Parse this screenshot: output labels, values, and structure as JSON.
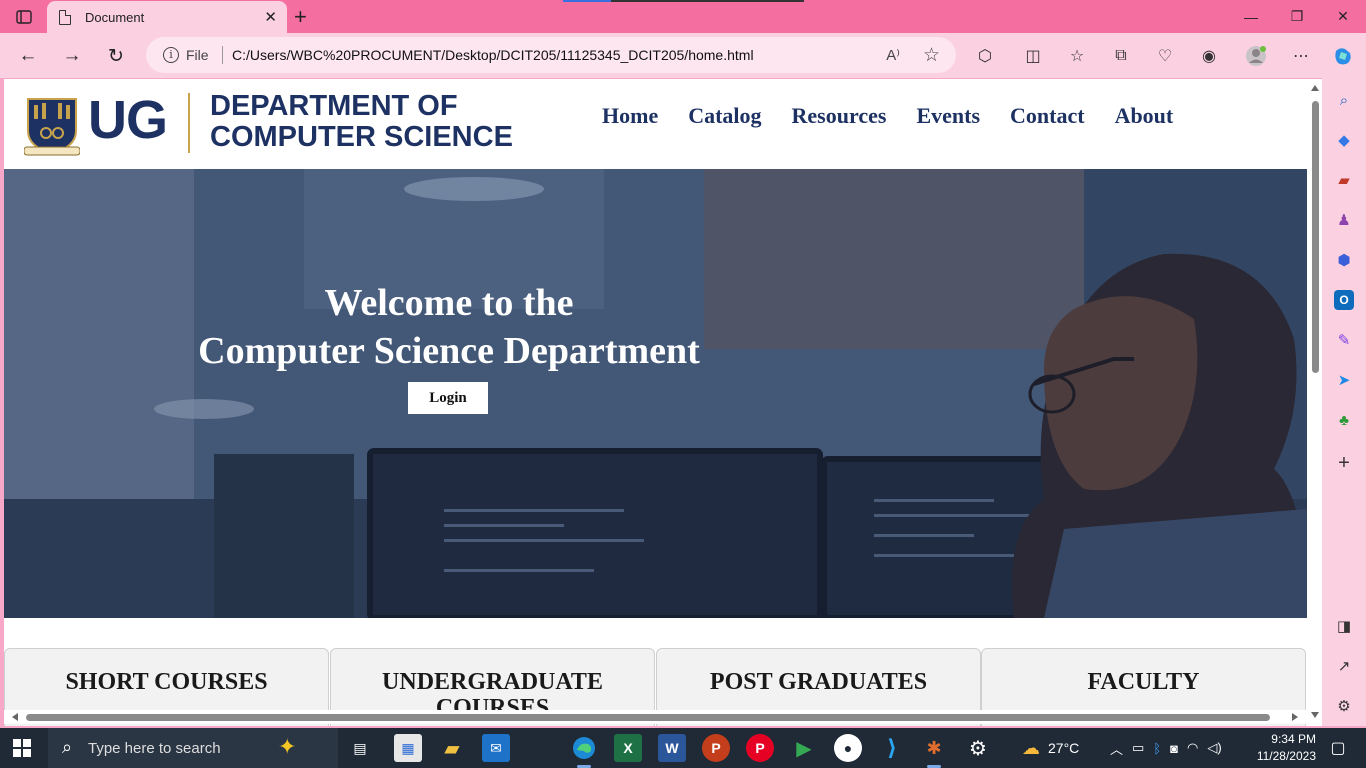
{
  "browser": {
    "tab_title": "Document",
    "file_label": "File",
    "url": "C:/Users/WBC%20PROCUMENT/Desktop/DCIT205/11125345_DCIT205/home.html",
    "read_aloud_glyph": "A⁾"
  },
  "site": {
    "logo_ug": "UG",
    "logo_line1": "DEPARTMENT OF",
    "logo_line2": "COMPUTER SCIENCE",
    "nav": [
      "Home",
      "Catalog",
      "Resources",
      "Events",
      "Contact",
      "About"
    ],
    "hero_line1": "Welcome to the",
    "hero_line2": "Computer Science Department",
    "login_label": "Login",
    "cards": [
      "SHORT COURSES",
      "UNDERGRADUATE COURSES",
      "POST GRADUATES",
      "FACULTY"
    ]
  },
  "taskbar": {
    "search_placeholder": "Type here to search",
    "weather": "27°C",
    "time": "9:34 PM",
    "date": "11/28/2023"
  },
  "colors": {
    "title_bar": "#f46e9f",
    "toolbar": "#fbd0e0",
    "brand_navy": "#1d3263",
    "brand_gold": "#c8a34c",
    "taskbar": "#1f2a36"
  }
}
